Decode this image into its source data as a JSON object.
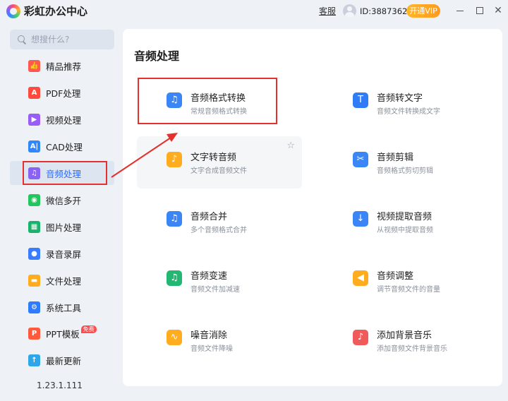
{
  "app": {
    "title": "彩虹办公中心",
    "service_label": "客服",
    "user_id": "ID:38873626",
    "vip_label": "开通VIP"
  },
  "window_controls": {
    "minimize": "minimize",
    "maximize": "maximize",
    "close": "✕"
  },
  "search": {
    "placeholder": "想搜什么?"
  },
  "sidebar": {
    "items": [
      {
        "label": "精品推荐",
        "icon": "thumbs-up-icon",
        "color": "#ff5a4d"
      },
      {
        "label": "PDF处理",
        "icon": "pdf-icon",
        "color": "#ff4a3d"
      },
      {
        "label": "视频处理",
        "icon": "video-icon",
        "color": "#9a5cf6"
      },
      {
        "label": "CAD处理",
        "icon": "cad-icon",
        "color": "#2f86ff"
      },
      {
        "label": "音频处理",
        "icon": "music-icon",
        "color": "#8a63f5"
      },
      {
        "label": "微信多开",
        "icon": "wechat-icon",
        "color": "#22c55e"
      },
      {
        "label": "图片处理",
        "icon": "image-icon",
        "color": "#19b36b"
      },
      {
        "label": "录音录屏",
        "icon": "microphone-icon",
        "color": "#3a7cff"
      },
      {
        "label": "文件处理",
        "icon": "folder-icon",
        "color": "#ffad1f"
      },
      {
        "label": "系统工具",
        "icon": "gear-icon",
        "color": "#2f7bff"
      },
      {
        "label": "PPT模板",
        "icon": "ppt-icon",
        "color": "#ff5a3c"
      },
      {
        "label": "最新更新",
        "icon": "upload-icon",
        "color": "#2fa6e8"
      }
    ],
    "free_badge": "免费",
    "version": "1.23.1.111"
  },
  "main": {
    "title": "音频处理",
    "cards": [
      {
        "title": "音频格式转换",
        "desc": "常规音频格式转换",
        "icon": "audio-convert-icon",
        "color": "#3a86f7"
      },
      {
        "title": "音频转文字",
        "desc": "音频文件转换成文字",
        "icon": "audio-to-text-icon",
        "color": "#2f7cf6"
      },
      {
        "title": "文字转音频",
        "desc": "文字合成音频文件",
        "icon": "text-to-audio-icon",
        "color": "#ffad1f"
      },
      {
        "title": "音频剪辑",
        "desc": "音频格式剪切剪辑",
        "icon": "audio-cut-icon",
        "color": "#3a86f7"
      },
      {
        "title": "音频合并",
        "desc": "多个音频格式合并",
        "icon": "audio-merge-icon",
        "color": "#3a86f7"
      },
      {
        "title": "视频提取音频",
        "desc": "从视频中提取音频",
        "icon": "video-extract-audio-icon",
        "color": "#3a86f7"
      },
      {
        "title": "音频变速",
        "desc": "音频文件加减速",
        "icon": "audio-speed-icon",
        "color": "#22b873"
      },
      {
        "title": "音频调整",
        "desc": "调节音频文件的音量",
        "icon": "audio-volume-icon",
        "color": "#ffad1f"
      },
      {
        "title": "噪音消除",
        "desc": "音频文件降噪",
        "icon": "noise-removal-icon",
        "color": "#ffad1f"
      },
      {
        "title": "添加背景音乐",
        "desc": "添加音频文件背景音乐",
        "icon": "background-music-icon",
        "color": "#f05a5a"
      }
    ],
    "star_icon": "star-icon"
  }
}
